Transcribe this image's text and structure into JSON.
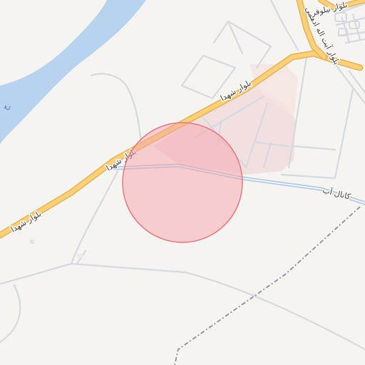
{
  "map": {
    "colors": {
      "background": "#f6f4f1",
      "water": "#b7d3ef",
      "major_road_fill": "#fbd07a",
      "major_road_casing": "#e5b355",
      "minor_road": "#d6d9e0",
      "canal": "#a9c6e8",
      "railway": "#8a8fa0",
      "landuse_pink": "#f2dede",
      "highlight_circle_fill": "#f6a4ab",
      "highlight_circle_stroke": "#e57682"
    },
    "labels": {
      "road_shohada_1": "بلوار شهدا",
      "road_shohada_2": "بلوار شهدا",
      "road_shohada_3": "بلوار شهدا",
      "road_ayatollah": "بلوار آیت اله ادهمی",
      "road_niloofar": "بلوار نیلوفر",
      "canal": "کانال آب",
      "water_char": "ج"
    }
  }
}
